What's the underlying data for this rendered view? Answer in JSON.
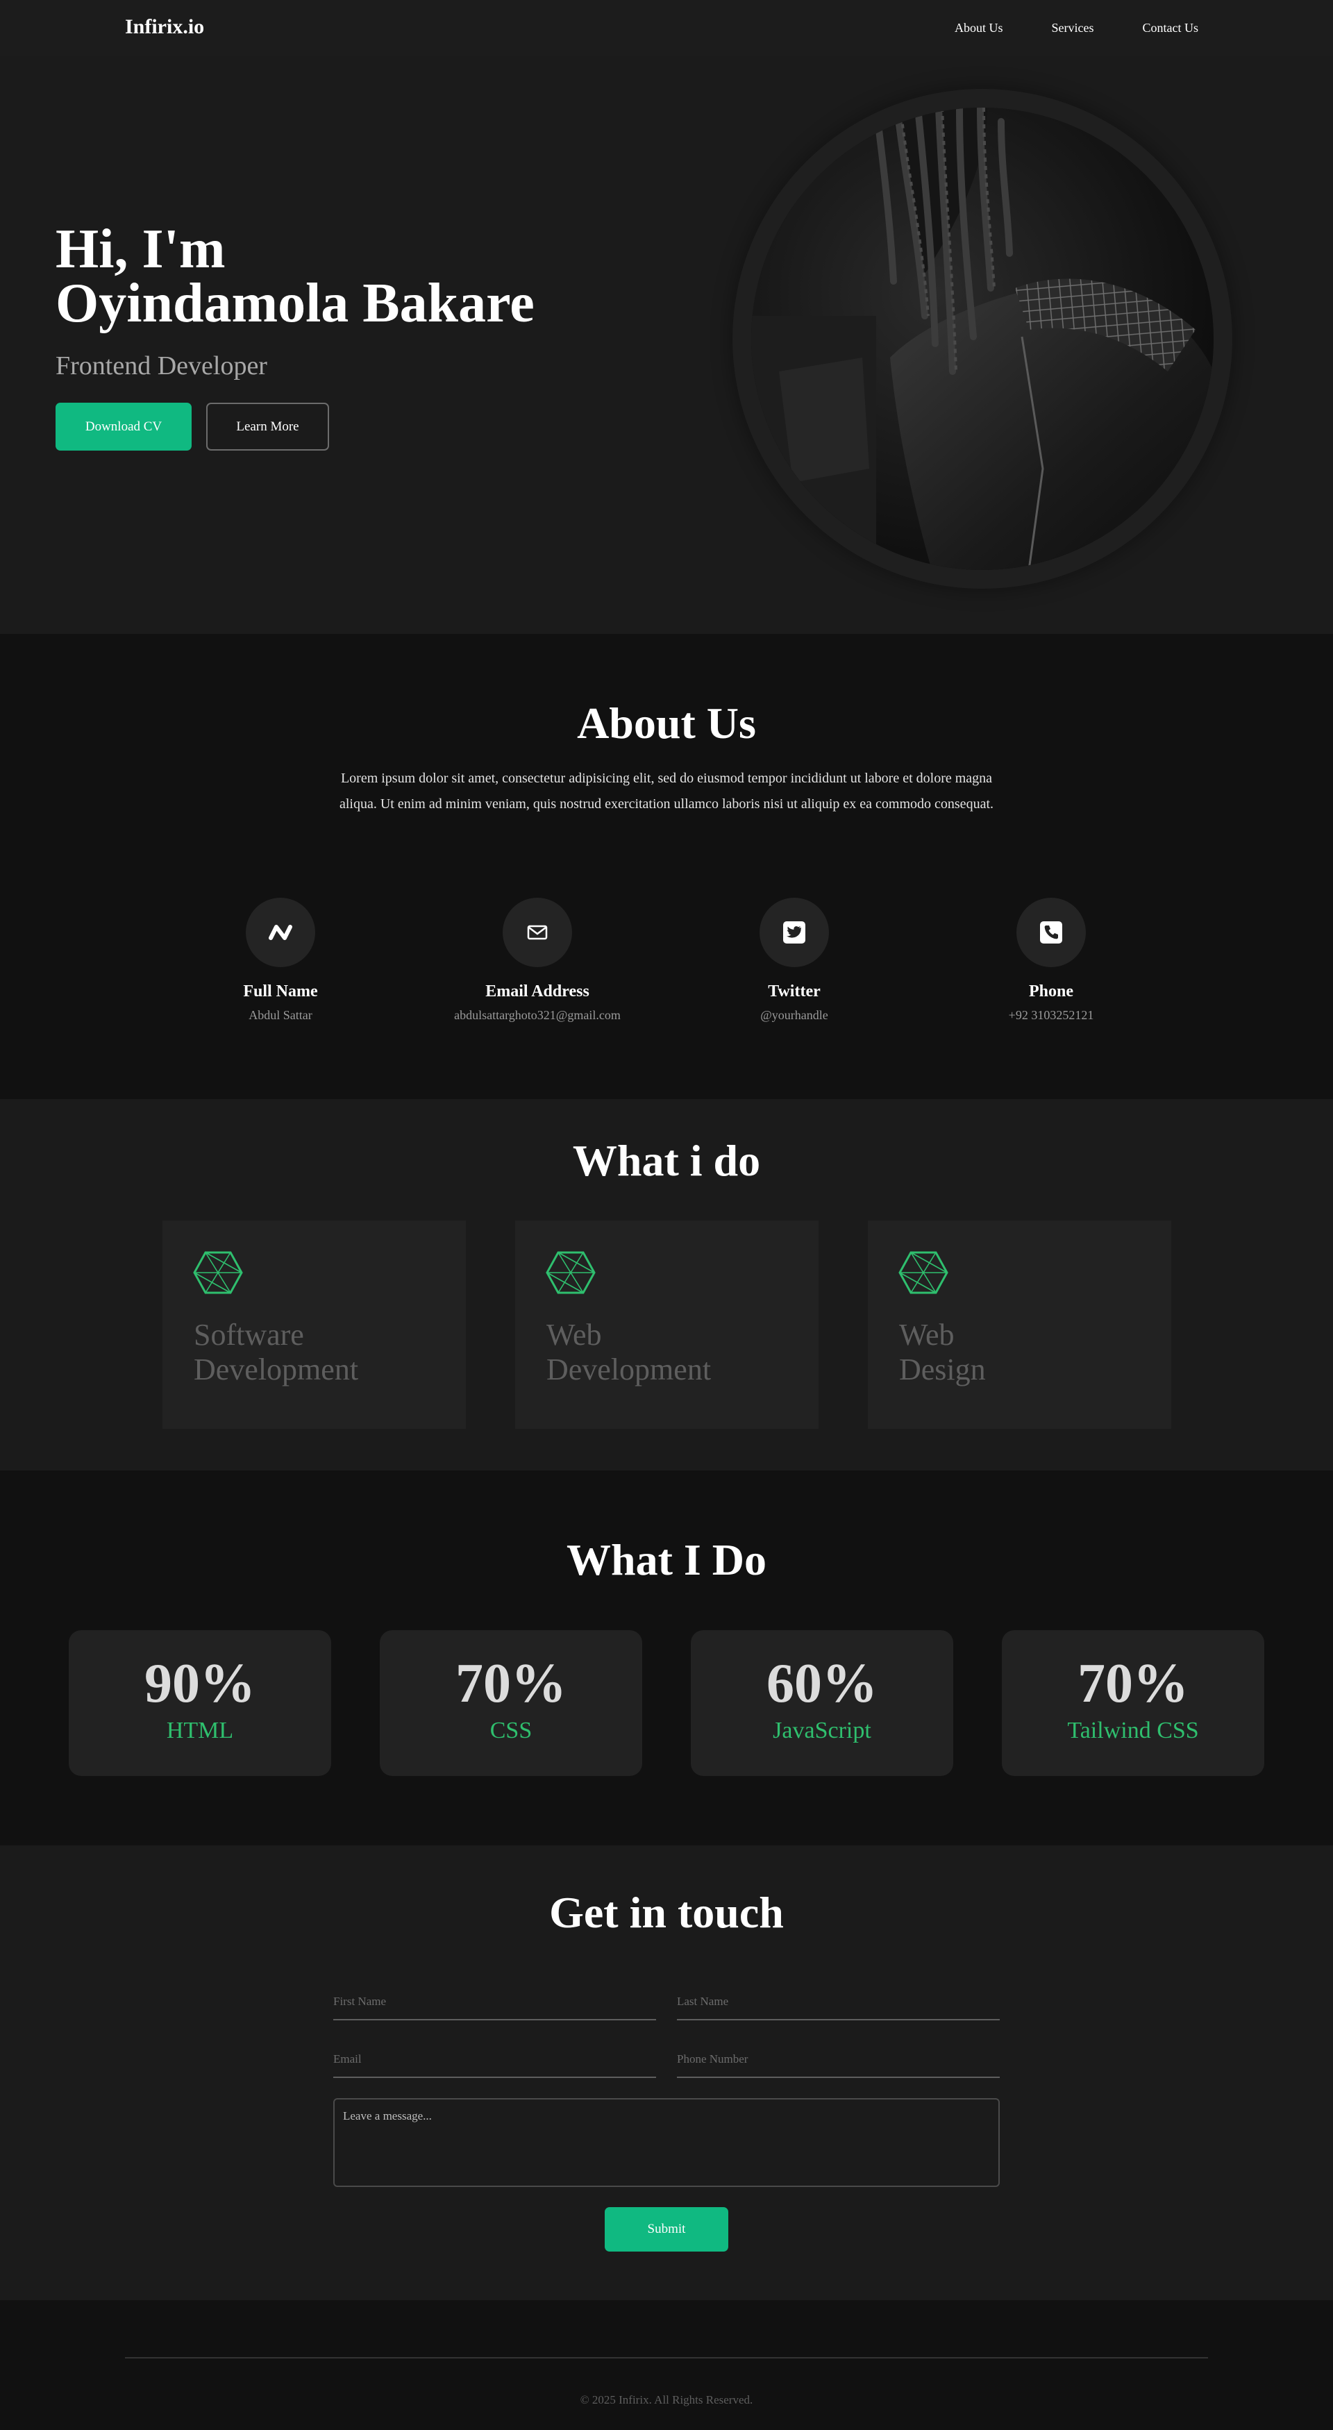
{
  "nav": {
    "brand": "Infirix.io",
    "links": [
      "About Us",
      "Services",
      "Contact Us"
    ]
  },
  "hero": {
    "title_line1": "Hi, I'm",
    "title_line2": "Oyindamola Bakare",
    "subtitle": "Frontend Developer",
    "primary_button": "Download CV",
    "secondary_button": "Learn More"
  },
  "about": {
    "title": "About Us",
    "text": "Lorem ipsum dolor sit amet, consectetur adipisicing elit, sed do eiusmod tempor incididunt ut labore et dolore magna aliqua. Ut enim ad minim veniam, quis nostrud exercitation ullamco laboris nisi ut aliquip ex ea commodo consequat.",
    "items": [
      {
        "label": "Full Name",
        "value": "Abdul Sattar",
        "icon": "n-logo-icon"
      },
      {
        "label": "Email Address",
        "value": "abdulsattarghoto321@gmail.com",
        "icon": "mail-icon"
      },
      {
        "label": "Twitter",
        "value": "@yourhandle",
        "icon": "twitter-icon"
      },
      {
        "label": "Phone",
        "value": "+92 3103252121",
        "icon": "phone-icon"
      }
    ]
  },
  "services": {
    "title": "What i do",
    "cards": [
      {
        "line1": "Software",
        "line2": "Development",
        "icon": "hexagon-icon"
      },
      {
        "line1": "Web",
        "line2": "Development",
        "icon": "hexagon-icon"
      },
      {
        "line1": "Web",
        "line2": "Design",
        "icon": "hexagon-icon"
      }
    ]
  },
  "skills": {
    "title": "What I Do",
    "items": [
      {
        "value": "90%",
        "name": "HTML"
      },
      {
        "value": "70%",
        "name": "CSS"
      },
      {
        "value": "60%",
        "name": "JavaScript"
      },
      {
        "value": "70%",
        "name": "Tailwind CSS"
      }
    ]
  },
  "contact": {
    "title": "Get in touch",
    "first_name_placeholder": "First Name",
    "last_name_placeholder": "Last Name",
    "email_placeholder": "Email",
    "phone_placeholder": "Phone Number",
    "message_placeholder": "Leave a message...",
    "submit_label": "Submit"
  },
  "footer": {
    "copyright": "© 2025 Infirix. All Rights Reserved."
  },
  "colors": {
    "accent": "#10b981",
    "skill_name": "#2fbf6e",
    "background": "#1b1b1b",
    "section_dark": "#111111",
    "card": "#222222"
  }
}
